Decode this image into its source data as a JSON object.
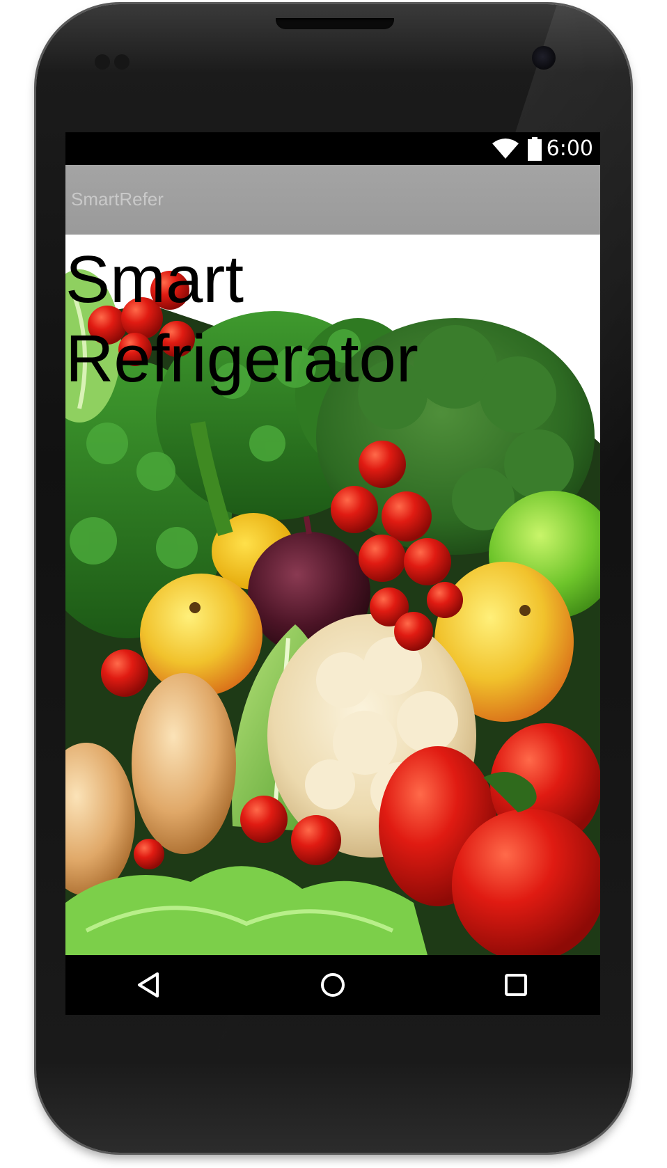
{
  "status_bar": {
    "time": "6:00",
    "icons": [
      "wifi-icon",
      "battery-icon"
    ]
  },
  "action_bar": {
    "app_title": "SmartRefer"
  },
  "main": {
    "headline": "Smart Refrigerator",
    "background_image": "vegetables-photo"
  },
  "nav_bar": {
    "buttons": [
      "back-icon",
      "home-icon",
      "recents-icon"
    ]
  },
  "colors": {
    "status_bar": "#000000",
    "action_bar": "#a0a0a0",
    "app_title": "#c9c9c9",
    "headline": "#000000",
    "nav_bar": "#000000"
  }
}
